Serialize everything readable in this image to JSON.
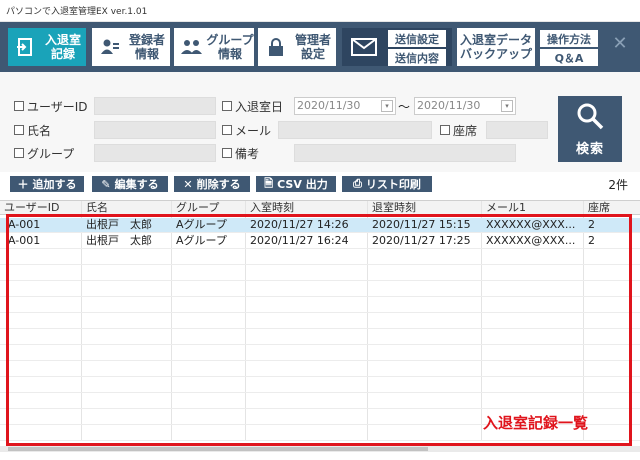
{
  "window": {
    "title": "パソコンで入退室管理EX ver.1.01"
  },
  "toolbar": {
    "entry_record": "入退室\n記録",
    "user_info": "登録者\n情報",
    "group_info": "グループ\n情報",
    "admin_settings": "管理者\n設定",
    "send_settings": "送信設定",
    "send_content": "送信内容",
    "backup": "入退室データ\nバックアップ",
    "how_to": "操作方法",
    "qa": "Q＆A"
  },
  "form": {
    "user_id_label": "ユーザーID",
    "entry_date_label": "入退室日",
    "date_from": "2020/11/30",
    "date_to": "2020/11/30",
    "range_sep": "〜",
    "name_label": "氏名",
    "mail_label": "メール",
    "seat_label": "座席",
    "group_label": "グループ",
    "note_label": "備考",
    "search_label": "検索"
  },
  "actions": {
    "add": "追加する",
    "edit": "編集する",
    "delete": "削除する",
    "csv": "CSV 出力",
    "print": "リスト印刷",
    "count": "2件"
  },
  "table": {
    "columns": [
      "ユーザーID",
      "氏名",
      "グループ",
      "入室時刻",
      "退室時刻",
      "メール1",
      "座席"
    ],
    "rows": [
      [
        "A-001",
        "出根戸　太郎",
        "Aグループ",
        "2020/11/27 14:26",
        "2020/11/27 15:15",
        "XXXXXX@XXX...",
        "2"
      ],
      [
        "A-001",
        "出根戸　太郎",
        "Aグループ",
        "2020/11/27 16:24",
        "2020/11/27 17:25",
        "XXXXXX@XXX...",
        "2"
      ]
    ]
  },
  "annotation": {
    "label": "入退室記録一覧",
    "color": "#e0141c"
  },
  "colors": {
    "navy": "#3f5873",
    "teal": "#1aa3b9",
    "selected_row": "#cfe9f8"
  }
}
